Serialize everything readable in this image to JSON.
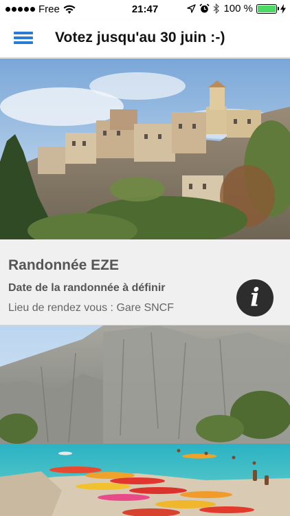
{
  "status_bar": {
    "carrier": "Free",
    "time": "21:47",
    "battery_percent": "100 %",
    "battery_level": 1.0,
    "icons": [
      "signal-dots-icon",
      "wifi-icon",
      "location-arrow-icon",
      "alarm-clock-icon",
      "bluetooth-icon",
      "battery-icon",
      "charging-bolt-icon"
    ]
  },
  "header": {
    "menu_icon": "hamburger-menu-icon",
    "title": "Votez jusqu'au 30 juin :-)"
  },
  "feed": {
    "cards": [
      {
        "image": "photo-eze-village",
        "title": "Randonnée EZE",
        "date": "Date de la randonnée à définir",
        "location": "Lieu de rendez vous : Gare SNCF",
        "info_icon": "info-icon",
        "info_glyph": "i"
      },
      {
        "image": "photo-calanques-kayaks"
      }
    ]
  },
  "colors": {
    "accent": "#2a7bd4",
    "battery": "#4cd964",
    "card_background": "#f0f0f0",
    "info_button": "#2d2d2d"
  }
}
